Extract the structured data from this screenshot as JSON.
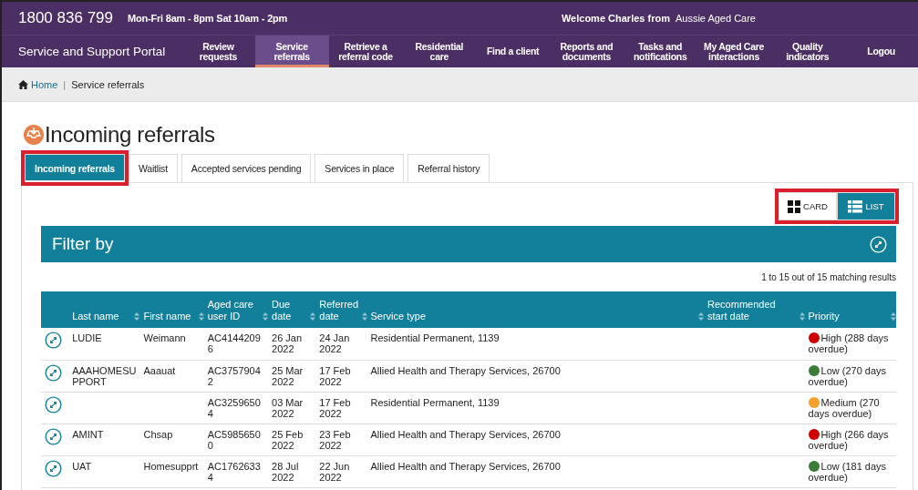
{
  "top_bar": {
    "phone": "1800 836 799",
    "hours": "Mon-Fri 8am - 8pm Sat 10am - 2pm",
    "welcome": "Welcome Charles from",
    "organisation": "Aussie Aged Care"
  },
  "nav": {
    "brand": "Service and Support Portal",
    "items": [
      {
        "label": "Review\nrequests",
        "selected": false
      },
      {
        "label": "Service\nreferrals",
        "selected": true
      },
      {
        "label": "Retrieve a\nreferral code",
        "selected": false
      },
      {
        "label": "Residential\ncare",
        "selected": false
      },
      {
        "label": "Find a client",
        "selected": false
      },
      {
        "label": "Reports and\ndocuments",
        "selected": false
      },
      {
        "label": "Tasks and\nnotifications",
        "selected": false
      },
      {
        "label": "My Aged Care\ninteractions",
        "selected": false
      },
      {
        "label": "Quality\nindicators",
        "selected": false
      },
      {
        "label": "Logou",
        "selected": false
      }
    ]
  },
  "breadcrumb": [
    {
      "label": "Home",
      "kind": "link"
    },
    {
      "separator": "|",
      "label": "Service referrals",
      "kind": "current"
    }
  ],
  "page_title": "Incoming referrals",
  "tabs": [
    {
      "label": "Incoming referrals",
      "selected": true,
      "highlighted": true
    },
    {
      "label": "Waitlist",
      "selected": false,
      "highlighted": false
    },
    {
      "label": "Accepted services pending",
      "selected": false,
      "highlighted": false
    },
    {
      "label": "Services in place",
      "selected": false,
      "highlighted": false
    },
    {
      "label": "Referral history",
      "selected": false,
      "highlighted": false
    }
  ],
  "view_toggle": {
    "highlighted": true,
    "options": [
      {
        "label": "CARD",
        "kind": "card",
        "selected": false
      },
      {
        "label": "LIST",
        "kind": "list",
        "selected": true
      }
    ]
  },
  "filter": {
    "title": "Filter by"
  },
  "results_count": "1 to 15 out of 15 matching results",
  "table": {
    "columns": [
      {
        "label": "Last name",
        "kind": "wrap"
      },
      {
        "label": "First name",
        "kind": "text"
      },
      {
        "label": "Aged care user ID",
        "kind": "wrap"
      },
      {
        "label": "Due date",
        "kind": "text"
      },
      {
        "label": "Referred date",
        "kind": "text"
      },
      {
        "label": "Service type",
        "kind": "text"
      },
      {
        "label": "Recommended start date",
        "kind": "text"
      },
      {
        "label": "Priority",
        "kind": "priority"
      }
    ],
    "rows": [
      {
        "cells": [
          "LUDIE",
          "Weimann",
          "AC41442096",
          "26 Jan 2022",
          "24 Jan 2022",
          "Residential Permanent, 1139",
          null,
          "High (288 days overdue)"
        ],
        "color": "#d10000"
      },
      {
        "cells": [
          "AAAHOMESUPPORT",
          "Aaauat",
          "AC37579042",
          "25 Mar 2022",
          "17 Feb 2022",
          "Allied Health and Therapy Services, 26700",
          null,
          "Low (270 days overdue)"
        ],
        "color": "#3a7d3a"
      },
      {
        "cells": [
          null,
          null,
          "AC32596504",
          "03 Mar 2022",
          "17 Feb 2022",
          "Residential Permanent, 1139",
          null,
          "Medium (270 days overdue)"
        ],
        "color": "#f5a02a"
      },
      {
        "cells": [
          "AMINT",
          "Chsap",
          "AC59856500",
          "25 Feb 2022",
          "23 Feb 2022",
          "Allied Health and Therapy Services, 26700",
          null,
          "High (266 days overdue)"
        ],
        "color": "#d10000"
      },
      {
        "cells": [
          "UAT",
          "Homesupprt",
          "AC17626334",
          "28 Jul 2022",
          "22 Jun 2022",
          "Allied Health and Therapy Services, 26700",
          null,
          "Low (181 days overdue)"
        ],
        "color": "#3a7d3a"
      }
    ]
  }
}
